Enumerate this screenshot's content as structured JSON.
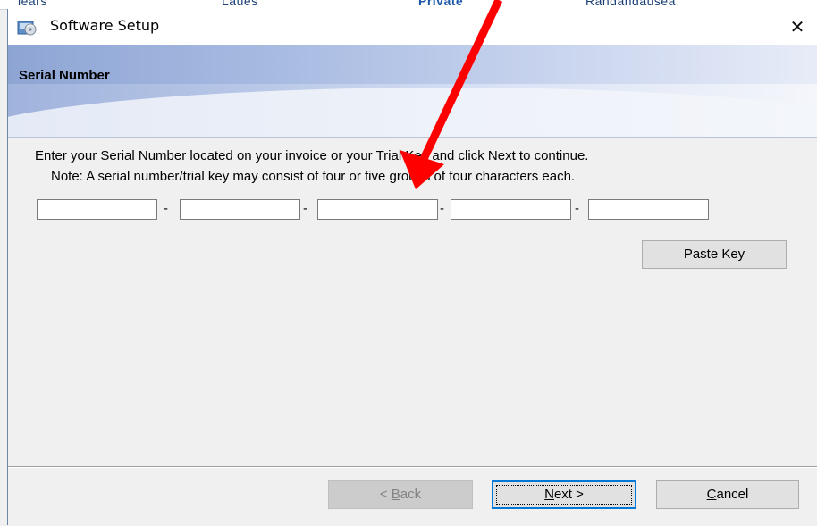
{
  "background_window": {
    "fragments": [
      "lears",
      "Laues",
      "Private",
      "Randandausea"
    ]
  },
  "window": {
    "title": "Software Setup",
    "icon": "setup-disc-icon",
    "close_glyph": "✕"
  },
  "banner": {
    "title": "Serial Number"
  },
  "content": {
    "instruction": "Enter your Serial Number located on your invoice or your Trial Key and click Next to continue.",
    "note": "Note: A serial number/trial key may consist of four or five groups of four characters each.",
    "key_fields": [
      {
        "value": "",
        "placeholder": ""
      },
      {
        "value": "",
        "placeholder": ""
      },
      {
        "value": "",
        "placeholder": ""
      },
      {
        "value": "",
        "placeholder": ""
      },
      {
        "value": "",
        "placeholder": ""
      }
    ],
    "separator": "-",
    "paste_key_label": "Paste Key"
  },
  "buttons": {
    "back": {
      "accel": "B",
      "rest": "ack",
      "prefix": "< "
    },
    "next": {
      "accel": "N",
      "rest": "ext >"
    },
    "cancel": {
      "accel": "C",
      "rest": "ancel"
    }
  },
  "colors": {
    "annotation_arrow": "#ff0000",
    "focus_border": "#0078d7"
  }
}
